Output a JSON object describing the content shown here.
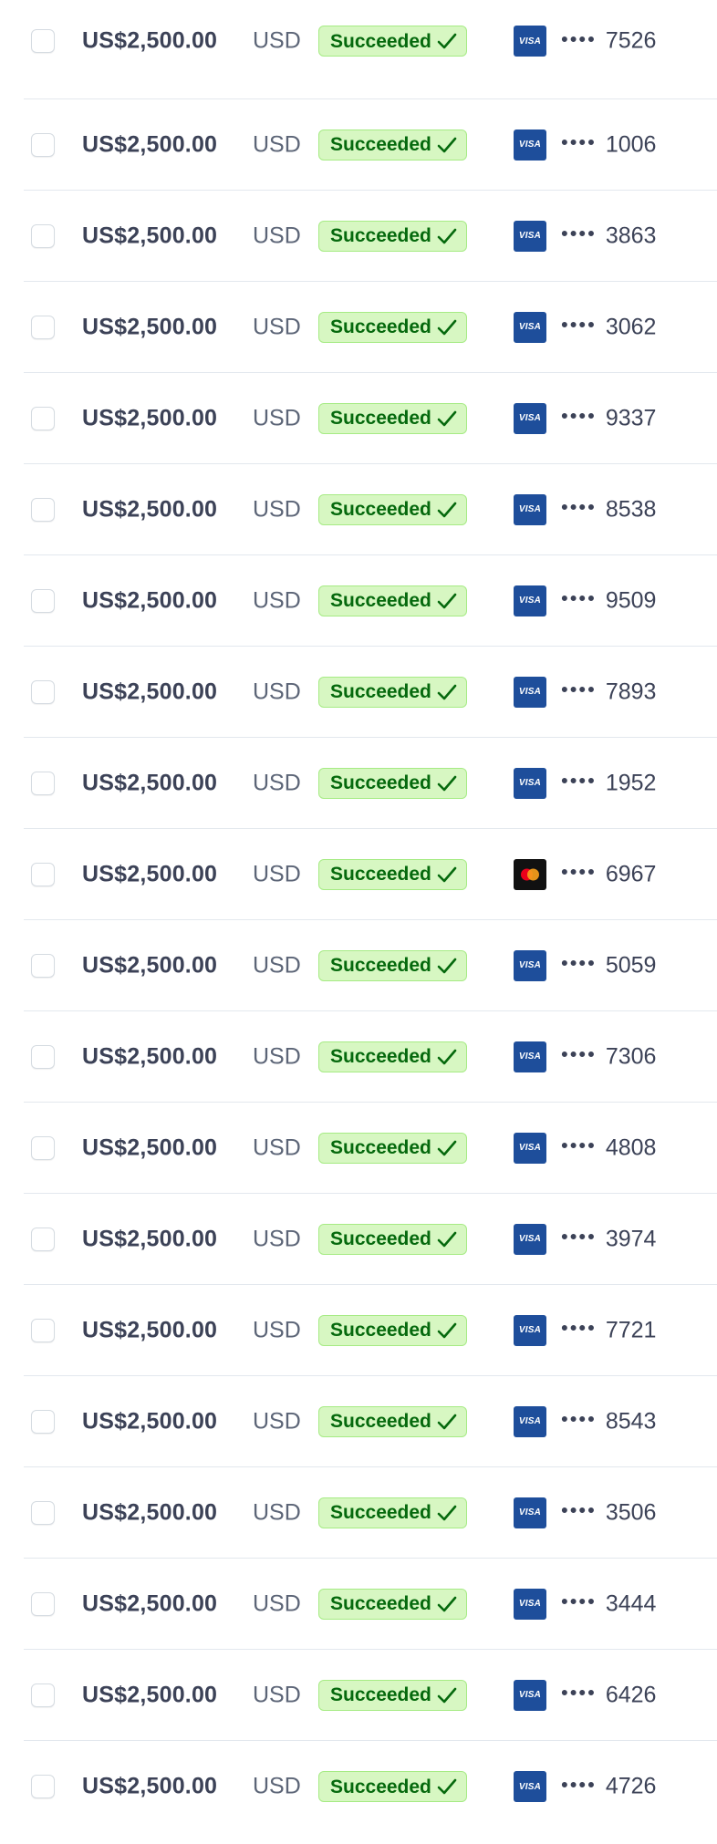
{
  "colors": {
    "badge_bg": "#d7f7c2",
    "badge_text": "#05690d",
    "visa_blue": "#1e4e9b",
    "amount_text": "#3c4257"
  },
  "masked_prefix": "••••",
  "payments": [
    {
      "amount": "US$2,500.00",
      "currency": "USD",
      "status": "Succeeded",
      "card_brand": "visa",
      "card_label": "VISA",
      "last4": "7526"
    },
    {
      "amount": "US$2,500.00",
      "currency": "USD",
      "status": "Succeeded",
      "card_brand": "visa",
      "card_label": "VISA",
      "last4": "1006"
    },
    {
      "amount": "US$2,500.00",
      "currency": "USD",
      "status": "Succeeded",
      "card_brand": "visa",
      "card_label": "VISA",
      "last4": "3863"
    },
    {
      "amount": "US$2,500.00",
      "currency": "USD",
      "status": "Succeeded",
      "card_brand": "visa",
      "card_label": "VISA",
      "last4": "3062"
    },
    {
      "amount": "US$2,500.00",
      "currency": "USD",
      "status": "Succeeded",
      "card_brand": "visa",
      "card_label": "VISA",
      "last4": "9337"
    },
    {
      "amount": "US$2,500.00",
      "currency": "USD",
      "status": "Succeeded",
      "card_brand": "visa",
      "card_label": "VISA",
      "last4": "8538"
    },
    {
      "amount": "US$2,500.00",
      "currency": "USD",
      "status": "Succeeded",
      "card_brand": "visa",
      "card_label": "VISA",
      "last4": "9509"
    },
    {
      "amount": "US$2,500.00",
      "currency": "USD",
      "status": "Succeeded",
      "card_brand": "visa",
      "card_label": "VISA",
      "last4": "7893"
    },
    {
      "amount": "US$2,500.00",
      "currency": "USD",
      "status": "Succeeded",
      "card_brand": "visa",
      "card_label": "VISA",
      "last4": "1952"
    },
    {
      "amount": "US$2,500.00",
      "currency": "USD",
      "status": "Succeeded",
      "card_brand": "mastercard",
      "card_label": "",
      "last4": "6967"
    },
    {
      "amount": "US$2,500.00",
      "currency": "USD",
      "status": "Succeeded",
      "card_brand": "visa",
      "card_label": "VISA",
      "last4": "5059"
    },
    {
      "amount": "US$2,500.00",
      "currency": "USD",
      "status": "Succeeded",
      "card_brand": "visa",
      "card_label": "VISA",
      "last4": "7306"
    },
    {
      "amount": "US$2,500.00",
      "currency": "USD",
      "status": "Succeeded",
      "card_brand": "visa",
      "card_label": "VISA",
      "last4": "4808"
    },
    {
      "amount": "US$2,500.00",
      "currency": "USD",
      "status": "Succeeded",
      "card_brand": "visa",
      "card_label": "VISA",
      "last4": "3974"
    },
    {
      "amount": "US$2,500.00",
      "currency": "USD",
      "status": "Succeeded",
      "card_brand": "visa",
      "card_label": "VISA",
      "last4": "7721"
    },
    {
      "amount": "US$2,500.00",
      "currency": "USD",
      "status": "Succeeded",
      "card_brand": "visa",
      "card_label": "VISA",
      "last4": "8543"
    },
    {
      "amount": "US$2,500.00",
      "currency": "USD",
      "status": "Succeeded",
      "card_brand": "visa",
      "card_label": "VISA",
      "last4": "3506"
    },
    {
      "amount": "US$2,500.00",
      "currency": "USD",
      "status": "Succeeded",
      "card_brand": "visa",
      "card_label": "VISA",
      "last4": "3444"
    },
    {
      "amount": "US$2,500.00",
      "currency": "USD",
      "status": "Succeeded",
      "card_brand": "visa",
      "card_label": "VISA",
      "last4": "6426"
    },
    {
      "amount": "US$2,500.00",
      "currency": "USD",
      "status": "Succeeded",
      "card_brand": "visa",
      "card_label": "VISA",
      "last4": "4726"
    }
  ]
}
